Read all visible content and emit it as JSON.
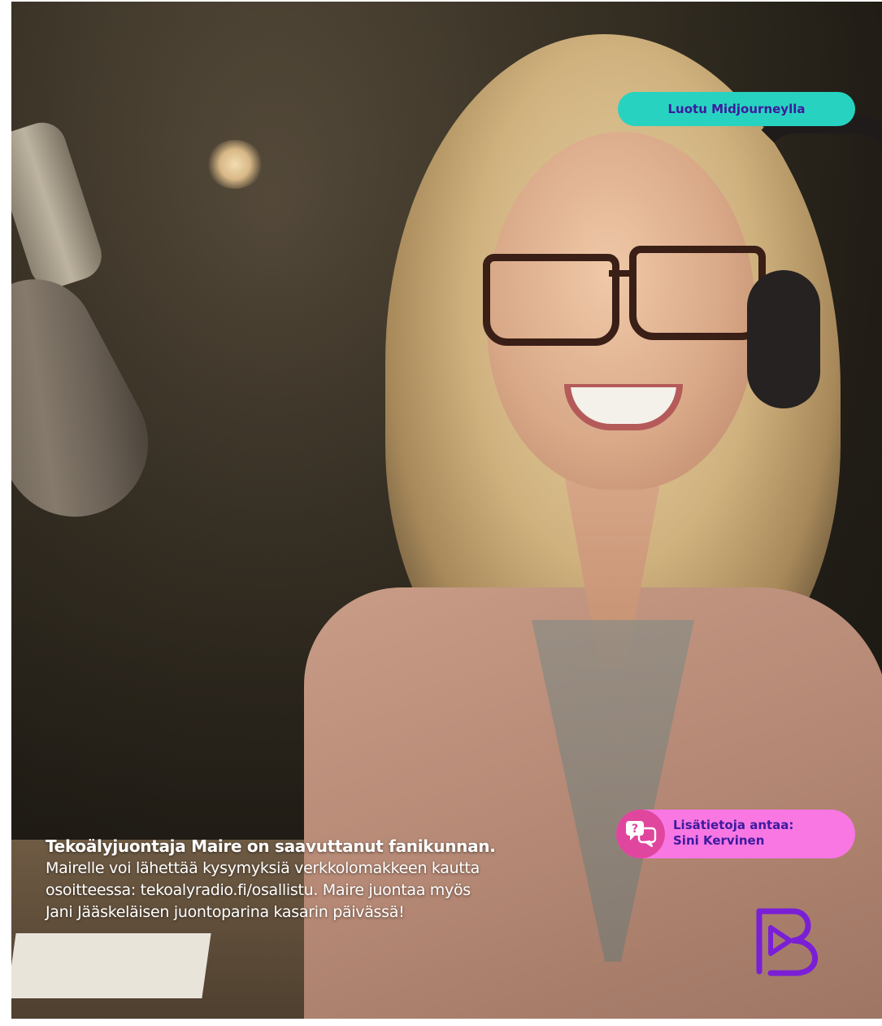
{
  "badge": {
    "label": "Luotu Midjourneylla"
  },
  "contact": {
    "line1": "Lisätietoja antaa:",
    "line2": "Sini Kervinen",
    "icon": "speech-bubbles-question-icon"
  },
  "caption": {
    "title": "Tekoälyjuontaja Maire on saavuttanut fanikunnan.",
    "line1": "Mairelle voi lähettää kysymyksiä verkkolomakkeen kautta",
    "line2": "osoitteessa: tekoalyradio.fi/osallistu. Maire juontaa myös",
    "line3": "Jani Jääskeläisen juontoparina kasarin päivässä!"
  },
  "colors": {
    "badge_bg": "#27d3c0",
    "pill_bg": "#f877e3",
    "icon_bg": "#e0469d",
    "text_purple": "#3d1a9e",
    "logo_purple": "#7a1fd6"
  }
}
